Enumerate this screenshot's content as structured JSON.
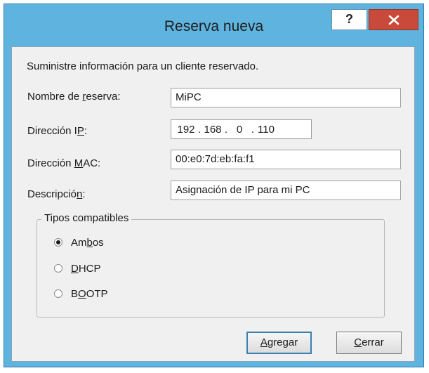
{
  "window": {
    "title": "Reserva nueva",
    "help_label": "?"
  },
  "dialog": {
    "instruction": "Suministre información para un cliente reservado."
  },
  "fields": {
    "nombre": {
      "label": "Nombre de reserva:",
      "value": "MiPC"
    },
    "ip": {
      "label": "Dirección IP:",
      "octets": [
        "192",
        "168",
        "0",
        "110"
      ]
    },
    "mac": {
      "label": "Dirección MAC:",
      "value": "00:e0:7d:eb:fa:f1"
    },
    "descripcion": {
      "label": "Descripción:",
      "value": "Asignación de IP para mi PC"
    }
  },
  "tipos": {
    "legend": "Tipos compatibles",
    "options": [
      {
        "label": "Ambos",
        "selected": true
      },
      {
        "label": "DHCP",
        "selected": false
      },
      {
        "label": "BOOTP",
        "selected": false
      }
    ]
  },
  "buttons": {
    "agregar": "Agregar",
    "cerrar": "Cerrar"
  },
  "colors": {
    "titlebar": "#5fb4df",
    "close_button": "#c84a3a",
    "client_bg": "#f0f0f0"
  },
  "icons": {
    "close": "close-icon",
    "help": "help-icon",
    "radio": "radio-icon"
  }
}
